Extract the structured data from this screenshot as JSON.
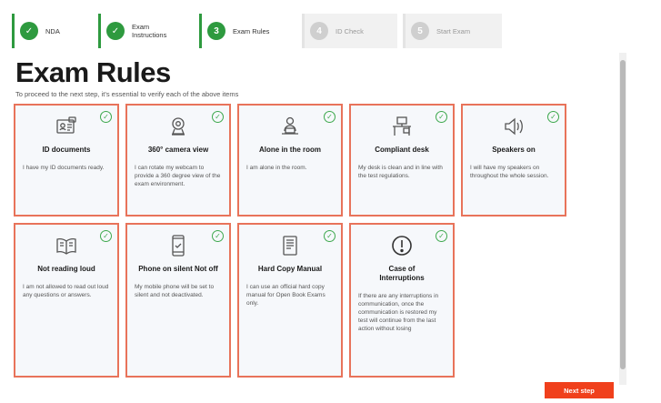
{
  "stepper": [
    {
      "label": "NDA",
      "icon": "✓",
      "state": "done"
    },
    {
      "label": "Exam Instructions",
      "icon": "✓",
      "state": "done"
    },
    {
      "label": "Exam Rules",
      "icon": "3",
      "state": "active"
    },
    {
      "label": "ID Check",
      "icon": "4",
      "state": "inactive"
    },
    {
      "label": "Start Exam",
      "icon": "5",
      "state": "inactive"
    }
  ],
  "page": {
    "title": "Exam Rules",
    "subtitle": "To proceed to the next step, it's essential to verify each of the above items"
  },
  "rules": [
    {
      "title": "ID documents",
      "desc": "I have my ID documents ready.",
      "icon": "id-card-icon"
    },
    {
      "title": "360° camera view",
      "desc": "I can rotate my webcam to provide a 360 degree view of the exam environment.",
      "icon": "webcam-icon"
    },
    {
      "title": "Alone in the room",
      "desc": "I am alone in the room.",
      "icon": "person-at-desk-icon"
    },
    {
      "title": "Compliant desk",
      "desc": "My desk is clean and in line with the test regulations.",
      "icon": "desk-icon"
    },
    {
      "title": "Speakers on",
      "desc": "I will have my speakers on throughout the whole session.",
      "icon": "speaker-icon"
    },
    {
      "title": "Not reading loud",
      "desc": "I am not allowed to read out loud any questions or answers.",
      "icon": "open-book-icon"
    },
    {
      "title": "Phone on silent Not off",
      "desc": "My mobile phone will be set to silent and not deactivated.",
      "icon": "mobile-phone-icon"
    },
    {
      "title": "Hard Copy Manual",
      "desc": "I can use an official hard copy manual for Open Book Exams only.",
      "icon": "manual-icon"
    },
    {
      "title": "Case of Interruptions",
      "desc": "If there are any interruptions in communication, once the communication is restored my test will continue from the last action without losing",
      "icon": "exclamation-icon"
    }
  ],
  "check_icon": "✓",
  "actions": {
    "next_label": "Next step"
  },
  "colors": {
    "accent": "#f0401c",
    "card_border": "#e8735a",
    "success": "#2e9a3f"
  }
}
